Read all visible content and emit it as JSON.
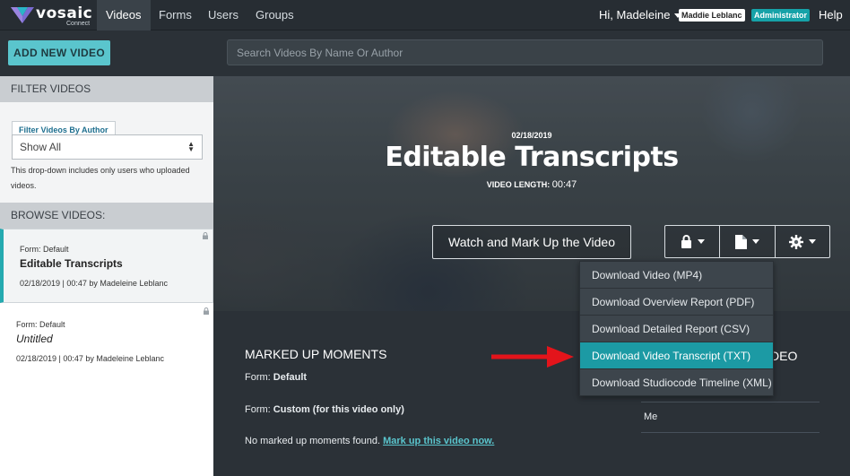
{
  "nav": {
    "logo_text": "vosaic",
    "logo_sub": "Connect",
    "items": [
      "Videos",
      "Forms",
      "Users",
      "Groups"
    ],
    "greeting": "Hi, Madeleine",
    "user_badge": "Maddie Leblanc",
    "role_badge": "Administrator",
    "help": "Help"
  },
  "toolbar": {
    "add_label": "ADD NEW VIDEO",
    "search_placeholder": "Search Videos By Name Or Author"
  },
  "sidebar": {
    "filter_heading": "FILTER VIDEOS",
    "filter_tab": "Filter Videos By Author",
    "filter_value": "Show All",
    "filter_help": "This drop-down includes only users who uploaded videos.",
    "browse_heading": "BROWSE VIDEOS:",
    "videos": [
      {
        "form": "Form: Default",
        "title": "Editable Transcripts",
        "meta": "02/18/2019 | 00:47 by Madeleine Leblanc"
      },
      {
        "form": "Form: Default",
        "title": "Untitled",
        "meta": "02/18/2019 | 00:47 by Madeleine Leblanc"
      }
    ]
  },
  "hero": {
    "date": "02/18/2019",
    "title": "Editable Transcripts",
    "length_label": "VIDEO LENGTH:",
    "length_value": "00:47",
    "watch_label": "Watch and Mark Up the Video"
  },
  "dropdown": {
    "items": [
      "Download Video (MP4)",
      "Download Overview Report (PDF)",
      "Download Detailed Report (CSV)",
      "Download Video Transcript (TXT)",
      "Download Studiocode Timeline (XML)"
    ],
    "highlighted": "Download Video Transcript (TXT)"
  },
  "moments": {
    "title": "MARKED UP MOMENTS",
    "form_default_label": "Form:",
    "form_default_value": "Default",
    "form_custom_label": "Form:",
    "form_custom_value": "Custom (for this video only)",
    "empty_text": "No marked up moments found.",
    "link_text": "Mark up this video now."
  },
  "right_column": {
    "title_fragment": "DEO",
    "me": "Me"
  },
  "colors": {
    "accent": "#5ac5cd",
    "highlight": "#1c9aa4",
    "arrow": "#e3141b"
  }
}
